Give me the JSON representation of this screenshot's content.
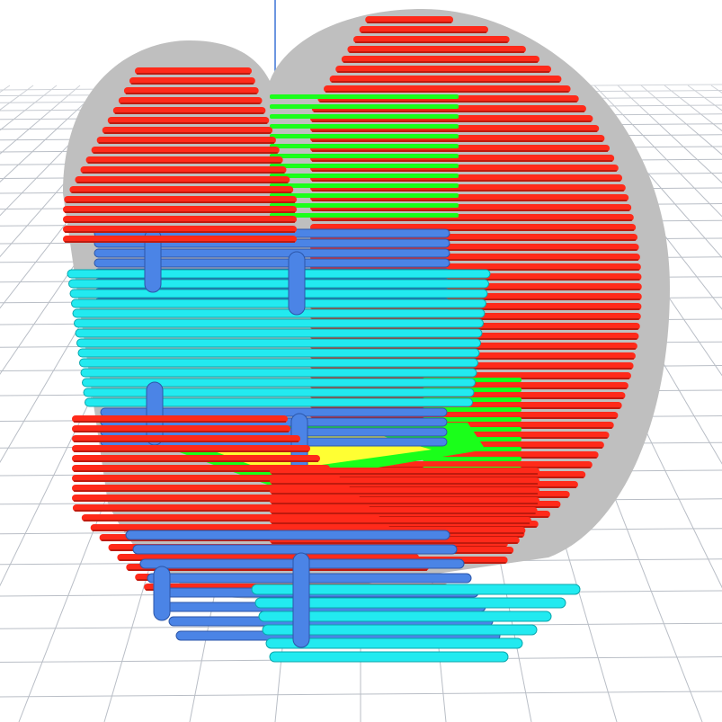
{
  "viewport": {
    "colors": {
      "background": "#ffffff",
      "grid": "#cfd3d8",
      "grid_line": "#b9bec6",
      "outer_wall": "#ff2a1a",
      "inner_wall": "#1aff1a",
      "infill": "#ffff33",
      "support": "#4b84e6",
      "support_interface": "#22eaf0",
      "model_shadow": "#bfbfbf",
      "axis_y": "#3b73d6"
    },
    "icons": {
      "grid": "build-plate-grid",
      "axis": "y-axis-line"
    }
  }
}
